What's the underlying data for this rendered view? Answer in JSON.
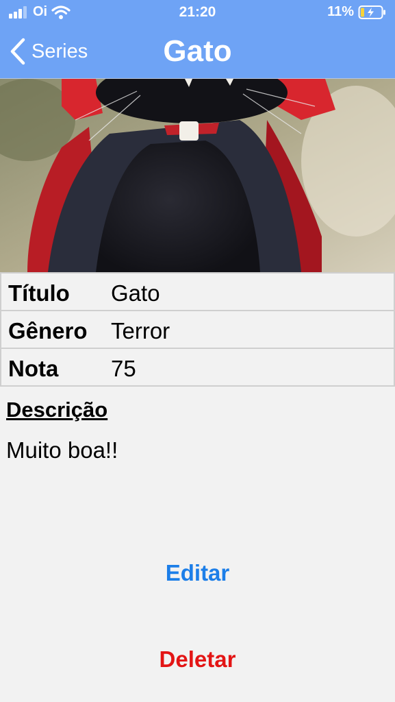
{
  "status_bar": {
    "carrier": "Oi",
    "time": "21:20",
    "battery": "11%"
  },
  "nav": {
    "back_label": "Series",
    "title": "Gato"
  },
  "details": [
    {
      "key": "Título",
      "value": "Gato"
    },
    {
      "key": "Gênero",
      "value": "Terror"
    },
    {
      "key": "Nota",
      "value": "75"
    }
  ],
  "description": {
    "heading": "Descrição",
    "text": "Muito boa!!"
  },
  "actions": {
    "edit_label": "Editar",
    "delete_label": "Deletar"
  },
  "colors": {
    "bar": "#6ea3f5",
    "edit": "#1c7ee8",
    "delete": "#e31515"
  }
}
